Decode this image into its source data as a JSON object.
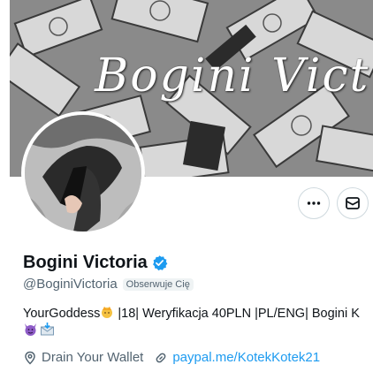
{
  "banner": {
    "text": "Bogini Vict"
  },
  "profile": {
    "display_name": "Bogini Victoria",
    "handle": "@BoginiVictoria",
    "follows_you": "Obserwuje Cię",
    "bio_prefix": "YourGoddess",
    "bio_suffix": " |18| Weryfikacja 40PLN |PL/ENG| Bogini K",
    "location": "Drain Your Wallet",
    "link": "paypal.me/KotekKotek21"
  },
  "icons": {
    "more": "more-dots-icon",
    "message": "message-envelope-icon",
    "verified": "verified-badge-icon",
    "location": "location-pin-icon",
    "link": "link-chain-icon"
  },
  "colors": {
    "accent": "#1d9bf0",
    "secondary_text": "#536471",
    "border": "#cfd9de"
  }
}
